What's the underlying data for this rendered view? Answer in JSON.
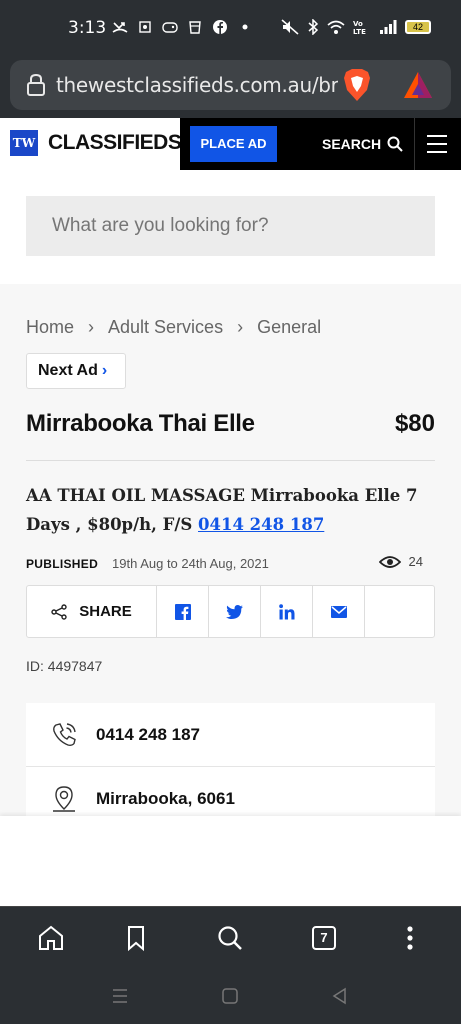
{
  "status_bar": {
    "time": "3:13",
    "battery": "42",
    "icons_left": [
      "missed-call-icon",
      "screenshot-icon",
      "gamepad-icon",
      "cup-icon",
      "facebook-icon",
      "dot-icon"
    ],
    "icons_right": [
      "mute-icon",
      "bluetooth-icon",
      "wifi-icon",
      "volte-icon",
      "signal-icon",
      "battery-icon"
    ]
  },
  "browser": {
    "url": "thewestclassifieds.com.au/br",
    "tab_count": "7"
  },
  "site": {
    "logo_mark": "TW",
    "logo_text": "CLASSIFIEDS",
    "place_ad_label": "PLACE AD",
    "search_label": "SEARCH",
    "search_placeholder": "What are you looking for?"
  },
  "breadcrumb": [
    "Home",
    "Adult Services",
    "General"
  ],
  "next_ad_label": "Next Ad",
  "ad": {
    "title": "Mirrabooka Thai Elle",
    "price": "$80",
    "description": "AA THAI OIL MASSAGE Mirrabooka Elle 7 Days , $80p/h, F/S",
    "description_phone": "0414 248 187",
    "published_label": "PUBLISHED",
    "published_dates": "19th Aug to 24th Aug, 2021",
    "views": "24",
    "share_label": "SHARE",
    "id_text": "ID: 4497847",
    "contact_phone": "0414 248 187",
    "location": "Mirrabooka, 6061"
  },
  "colors": {
    "accent": "#1155e6",
    "header_dark": "#000000",
    "chrome": "#2b2f33"
  }
}
